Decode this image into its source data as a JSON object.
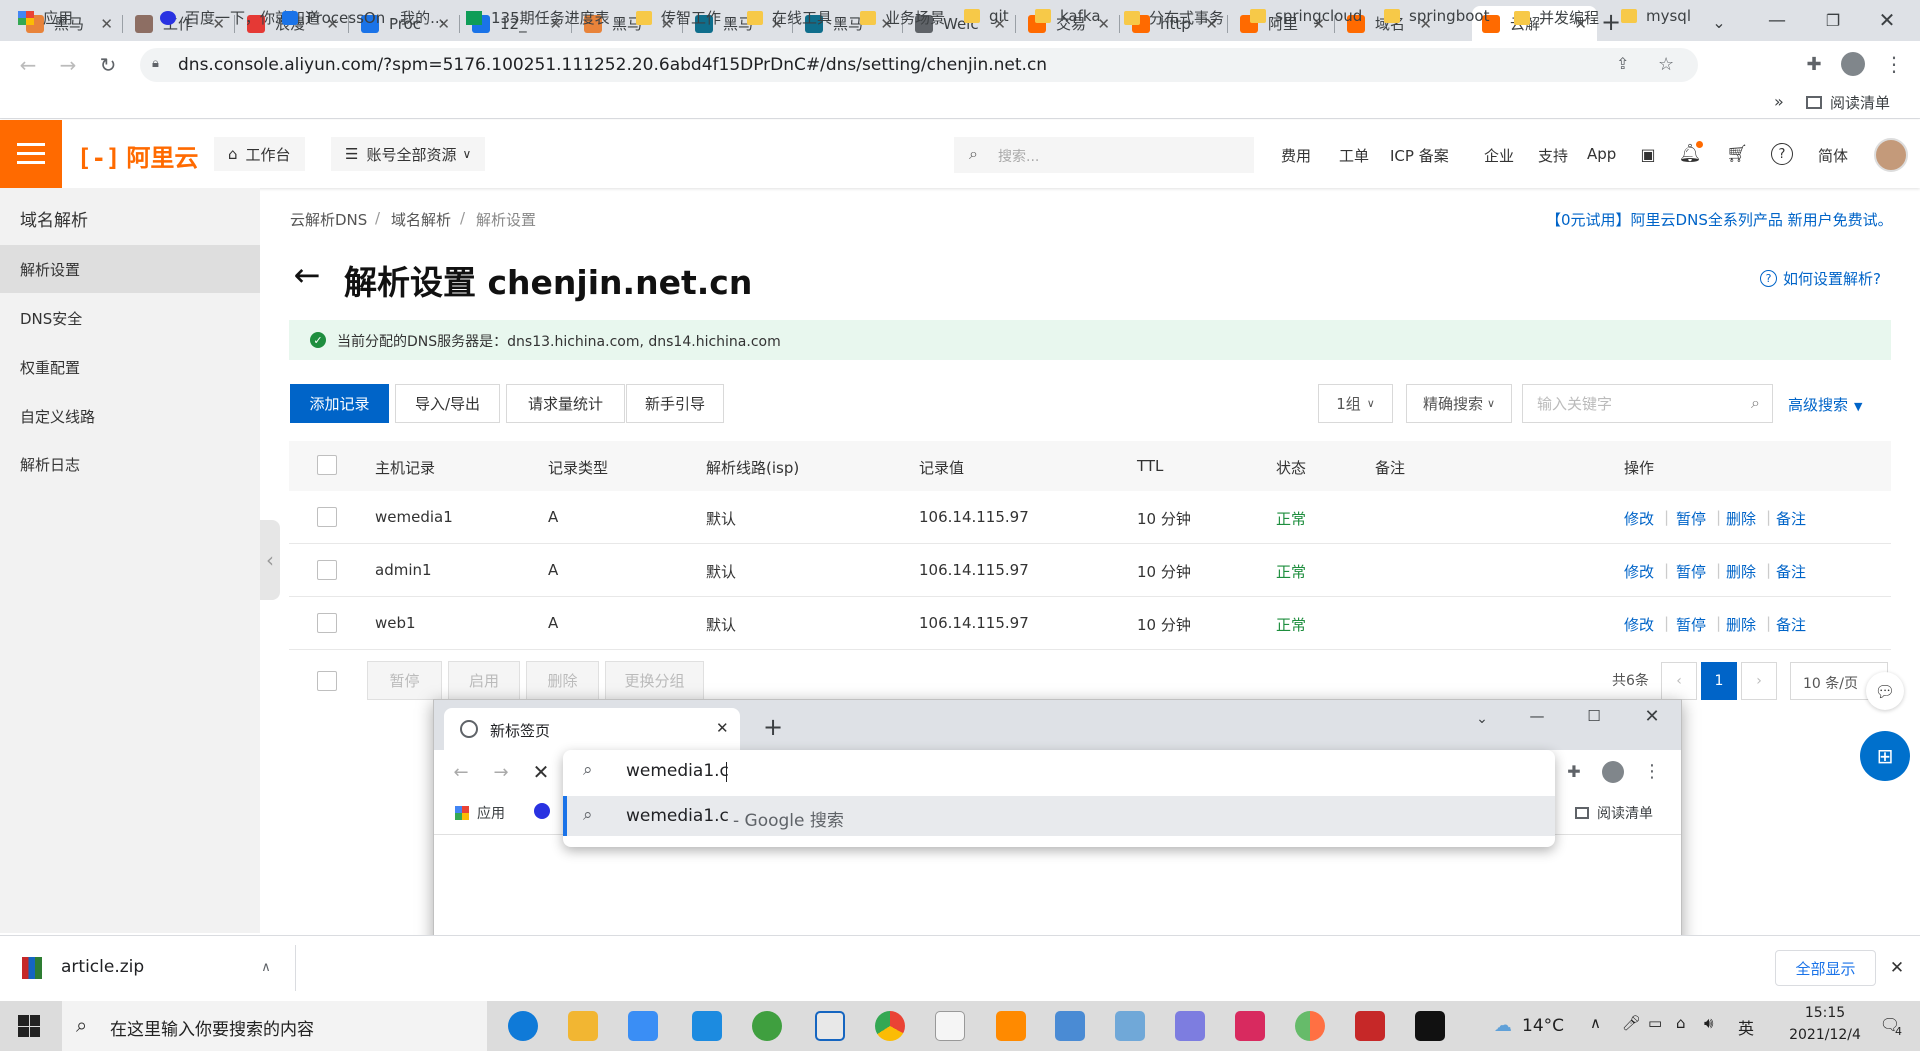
{
  "browser": {
    "tabs": [
      {
        "title": "黑马",
        "icon": "orange-doc-icon",
        "color": "#e8833a"
      },
      {
        "title": "工作",
        "icon": "avatar-icon",
        "color": "#8d6e63"
      },
      {
        "title": "浪漫",
        "icon": "g-icon",
        "color": "#e53935"
      },
      {
        "title": "Proc",
        "icon": "processon-icon",
        "color": "#1a73e8"
      },
      {
        "title": "12_",
        "icon": "processon-icon",
        "color": "#1a73e8"
      },
      {
        "title": "黑马",
        "icon": "orange-doc-icon",
        "color": "#e8833a"
      },
      {
        "title": "黑马",
        "icon": "blue-leaf-icon",
        "color": "#0f6e8c"
      },
      {
        "title": "黑马",
        "icon": "blue-leaf-icon",
        "color": "#0f6e8c"
      },
      {
        "title": "Welc",
        "icon": "globe-icon",
        "color": "#5f6368"
      },
      {
        "title": "交易",
        "icon": "aliyun-icon",
        "color": "#ff6a00"
      },
      {
        "title": "http",
        "icon": "aliyun-icon",
        "color": "#ff6a00"
      },
      {
        "title": "阿里",
        "icon": "aliyun-icon",
        "color": "#ff6a00"
      },
      {
        "title": "域名",
        "icon": "aliyun-icon",
        "color": "#ff6a00"
      },
      {
        "title": "云解",
        "icon": "aliyun-icon",
        "color": "#ff6a00"
      }
    ],
    "url": "dns.console.aliyun.com/?spm=5176.100251.111252.20.6abd4f15DPrDnC#/dns/setting/chenjin.net.cn",
    "bookmarks": [
      {
        "label": "应用",
        "icon": "apps-grid-icon"
      },
      {
        "label": "百度一下，你就知道",
        "icon": "baidu-paw-icon"
      },
      {
        "label": "ProcessOn - 我的...",
        "icon": "processon-icon"
      },
      {
        "label": "135期任务进度表",
        "icon": "sheet-icon"
      },
      {
        "label": "传智工作",
        "icon": "folder-icon"
      },
      {
        "label": "在线工具",
        "icon": "folder-icon"
      },
      {
        "label": "业务场景",
        "icon": "folder-icon"
      },
      {
        "label": "git",
        "icon": "folder-icon"
      },
      {
        "label": "kafka",
        "icon": "folder-icon"
      },
      {
        "label": "分布式事务",
        "icon": "folder-icon"
      },
      {
        "label": "springcloud",
        "icon": "folder-icon"
      },
      {
        "label": "springboot",
        "icon": "folder-icon"
      },
      {
        "label": "并发编程",
        "icon": "folder-icon"
      },
      {
        "label": "mysql",
        "icon": "folder-icon"
      }
    ],
    "more_bookmarks": "»",
    "reading_list": "阅读清单"
  },
  "header": {
    "logo": "阿里云",
    "workbench": "工作台",
    "resources": "账号全部资源",
    "search_placeholder": "搜索...",
    "nav": [
      "费用",
      "工单",
      "ICP 备案",
      "企业",
      "支持",
      "App"
    ],
    "lang": "简体",
    "brand_color": "#ff6a00"
  },
  "sidebar": {
    "title": "域名解析",
    "items": [
      "解析设置",
      "DNS安全",
      "权重配置",
      "自定义线路",
      "解析日志"
    ]
  },
  "main": {
    "breadcrumb": [
      "云解析DNS",
      "域名解析",
      "解析设置"
    ],
    "promo": "【0元试用】阿里云DNS全系列产品 新用户免费试。",
    "title_prefix": "解析设置",
    "domain": "chenjin.net.cn",
    "help": "如何设置解析?",
    "notice": "当前分配的DNS服务器是：dns13.hichina.com, dns14.hichina.com",
    "buttons": {
      "add": "添加记录",
      "import": "导入/导出",
      "stats": "请求量统计",
      "guide": "新手引导"
    },
    "group_select": "1组",
    "search_mode": "精确搜索",
    "keyword_placeholder": "输入关键字",
    "advanced": "高级搜索",
    "columns": [
      "主机记录",
      "记录类型",
      "解析线路(isp)",
      "记录值",
      "TTL",
      "状态",
      "备注",
      "操作"
    ],
    "rows": [
      {
        "host": "wemedia1",
        "type": "A",
        "line": "默认",
        "value": "106.14.115.97",
        "ttl": "10 分钟",
        "status": "正常",
        "note": ""
      },
      {
        "host": "admin1",
        "type": "A",
        "line": "默认",
        "value": "106.14.115.97",
        "ttl": "10 分钟",
        "status": "正常",
        "note": ""
      },
      {
        "host": "web1",
        "type": "A",
        "line": "默认",
        "value": "106.14.115.97",
        "ttl": "10 分钟",
        "status": "正常",
        "note": ""
      }
    ],
    "row_actions": [
      "修改",
      "暂停",
      "删除",
      "备注"
    ],
    "bulk": [
      "暂停",
      "启用",
      "删除",
      "更换分组"
    ],
    "total": "共6条",
    "page": "1",
    "page_size": "10 条/页"
  },
  "popup": {
    "tab_title": "新标签页",
    "input_value": "wemedia1.c",
    "suggestion_query": "wemedia1.c",
    "suggestion_suffix": "- Google 搜索",
    "bookmark_apps": "应用",
    "reading_list": "阅读清单"
  },
  "download": {
    "file": "article.zip",
    "show_all": "全部显示"
  },
  "taskbar": {
    "search_placeholder": "在这里输入你要搜索的内容",
    "weather": "14°C",
    "ime": "英",
    "time": "15:15",
    "date": "2021/12/4",
    "notifications": "4"
  }
}
